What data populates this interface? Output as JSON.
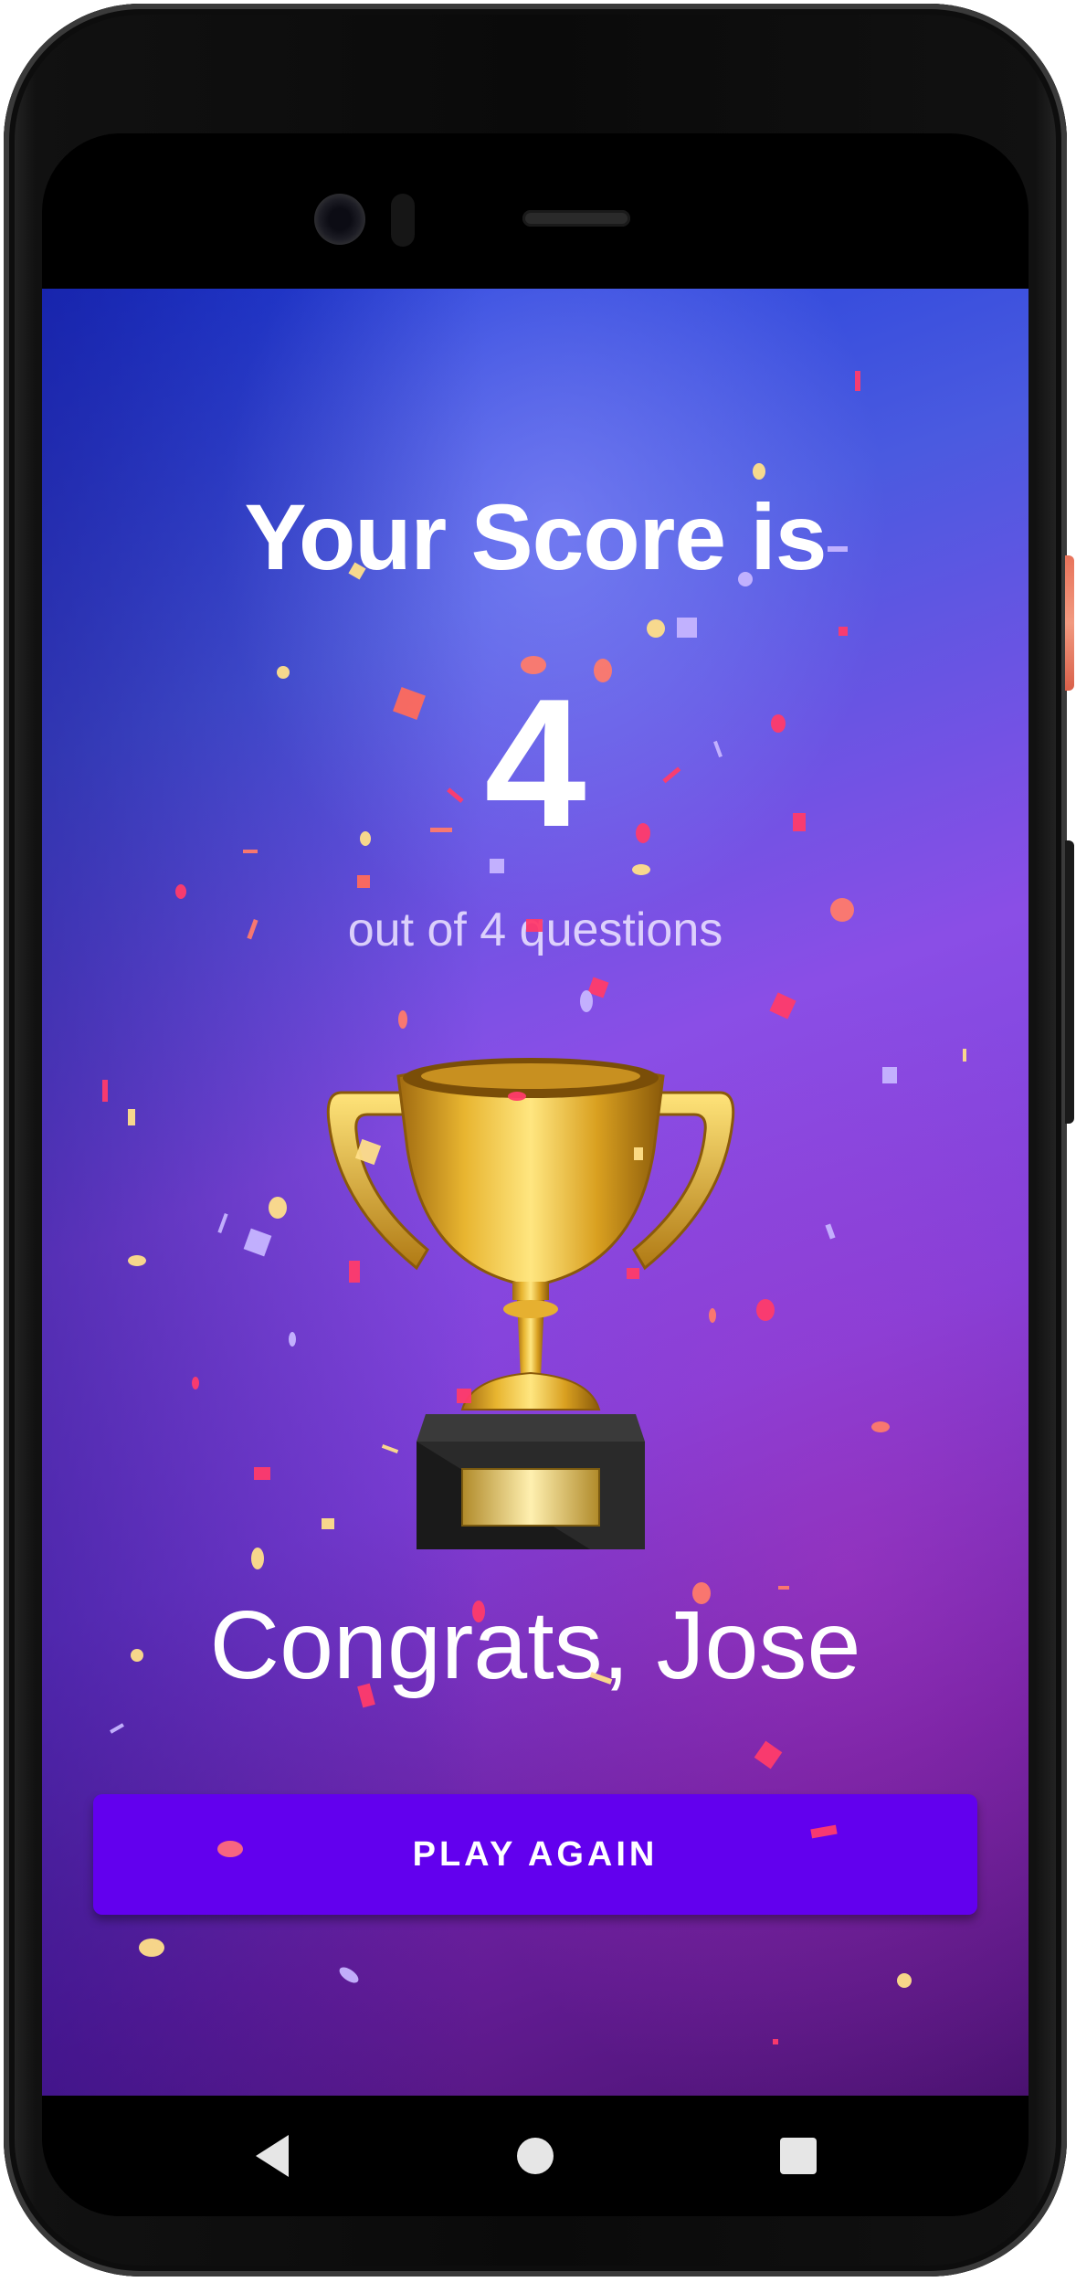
{
  "score_screen": {
    "title": "Your Score is",
    "score": "4",
    "subtitle": "out of 4 questions",
    "congrats": "Congrats, Jose",
    "play_again_label": "PLAY AGAIN"
  },
  "icons": {
    "trophy": "trophy-icon",
    "nav_back": "back-triangle-icon",
    "nav_home": "home-circle-icon",
    "nav_recent": "recents-square-icon"
  },
  "colors": {
    "button": "#6200ee",
    "text": "#ffffff",
    "background_start": "#1a3ad8",
    "background_end": "#6a1f9e"
  }
}
